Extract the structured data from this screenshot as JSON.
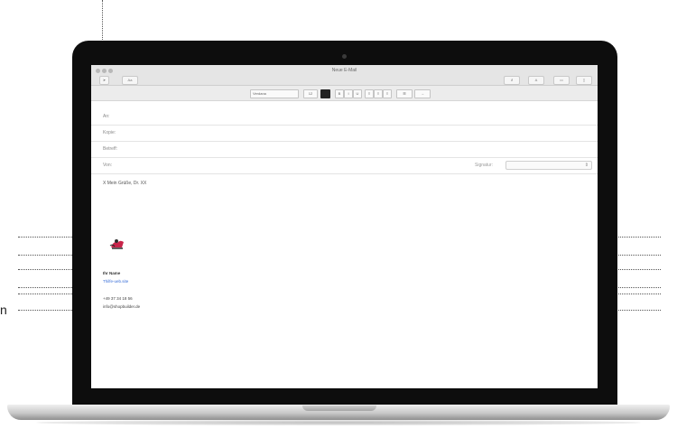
{
  "window": {
    "title": "Neue E-Mail"
  },
  "toolbar": {
    "send_icon": "paper-plane-icon",
    "attach_icon": "paperclip-icon",
    "text_format_label": "A",
    "photo_icon": "photo-icon",
    "browser_icon": "media-icon",
    "left_button_label": "Aa"
  },
  "format_bar": {
    "font_family": "Verdana",
    "font_size": "12",
    "text_color": "#1f1f1f",
    "bold": "B",
    "italic": "I",
    "underline": "U",
    "align": "≡",
    "list": "☰",
    "indent": "→"
  },
  "fields": {
    "to_label": "An:",
    "cc_label": "Kopie:",
    "subject_label": "Betreff:",
    "from_label": "Von:",
    "signature_label": "Signatur:"
  },
  "body": {
    "greeting": "X Mein Grüße, Dr. XX"
  },
  "signature": {
    "logo_name": "logo-icon",
    "name": "Ihr Name",
    "link": "Thilfe-ueb.site",
    "phone": "+49 37 34 18 56",
    "email": "info@shopbuilder.de"
  },
  "margin_char": "n"
}
